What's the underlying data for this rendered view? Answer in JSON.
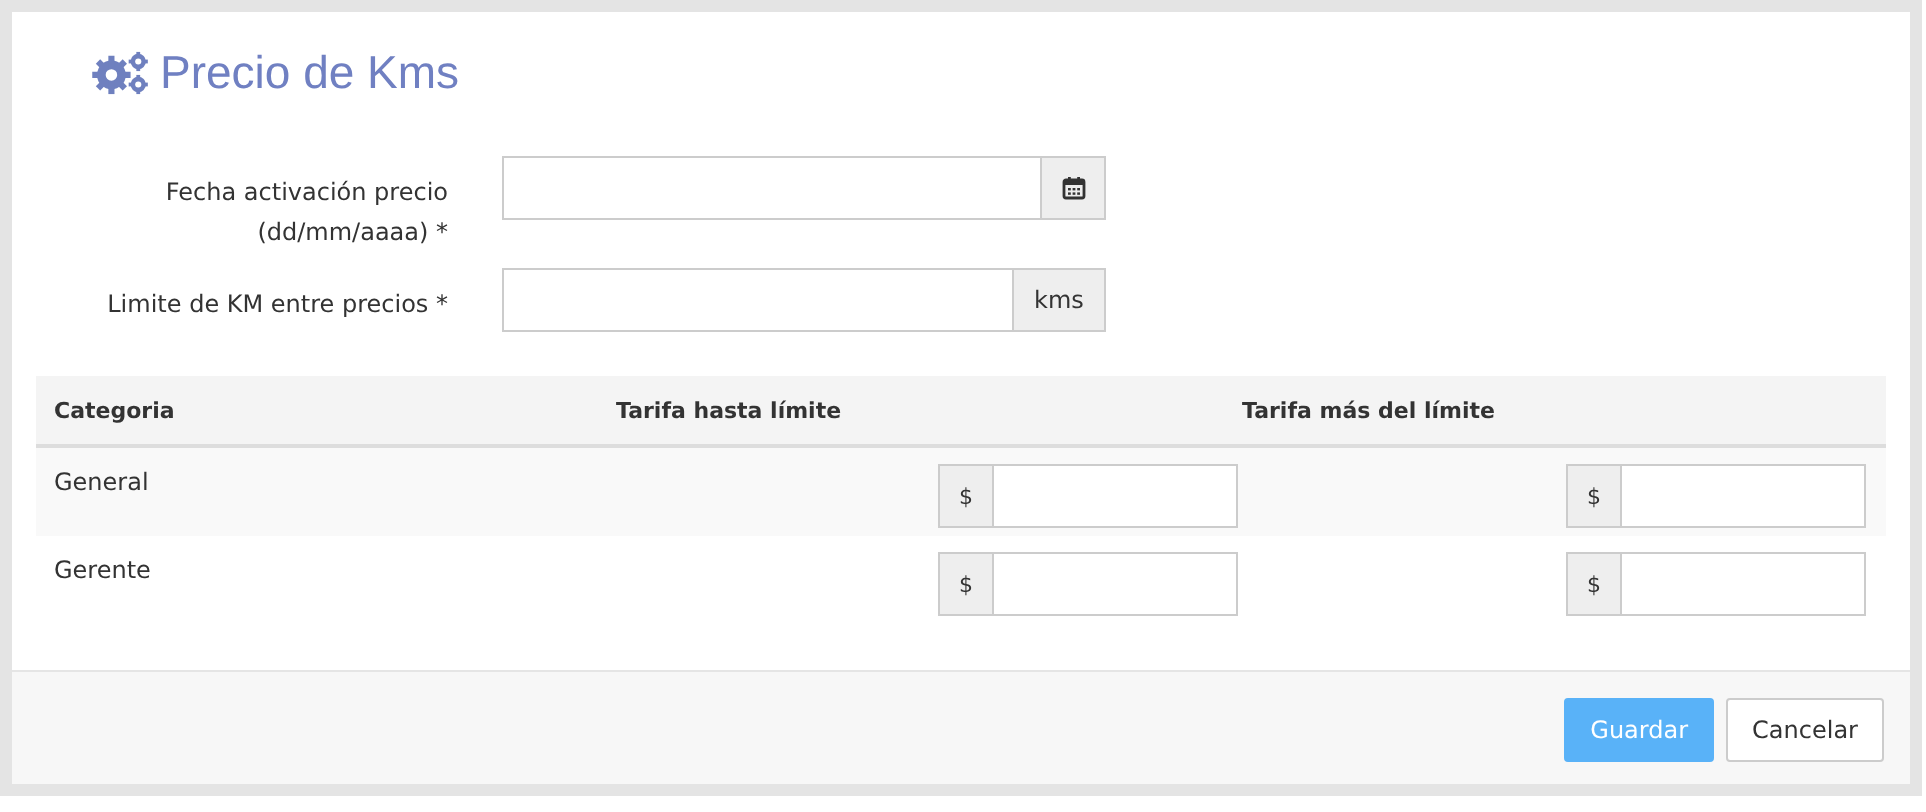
{
  "title": "Precio de Kms",
  "fields": [
    {
      "label": "Fecha activación precio (dd/mm/aaaa) *",
      "kind": "date"
    },
    {
      "label": "Limite de KM entre precios *",
      "kind": "unit",
      "addon": "kms"
    }
  ],
  "table": {
    "columns": [
      "Categoria",
      "Tarifa hasta límite",
      "Tarifa más del límite"
    ],
    "rows": [
      {
        "category": "General",
        "prefix_1": "$",
        "prefix_2": "$"
      },
      {
        "category": "Gerente",
        "prefix_1": "$",
        "prefix_2": "$"
      }
    ]
  },
  "buttons": [
    {
      "label": "Guardar",
      "kind": "primary"
    },
    {
      "label": "Cancelar",
      "kind": "default"
    }
  ]
}
